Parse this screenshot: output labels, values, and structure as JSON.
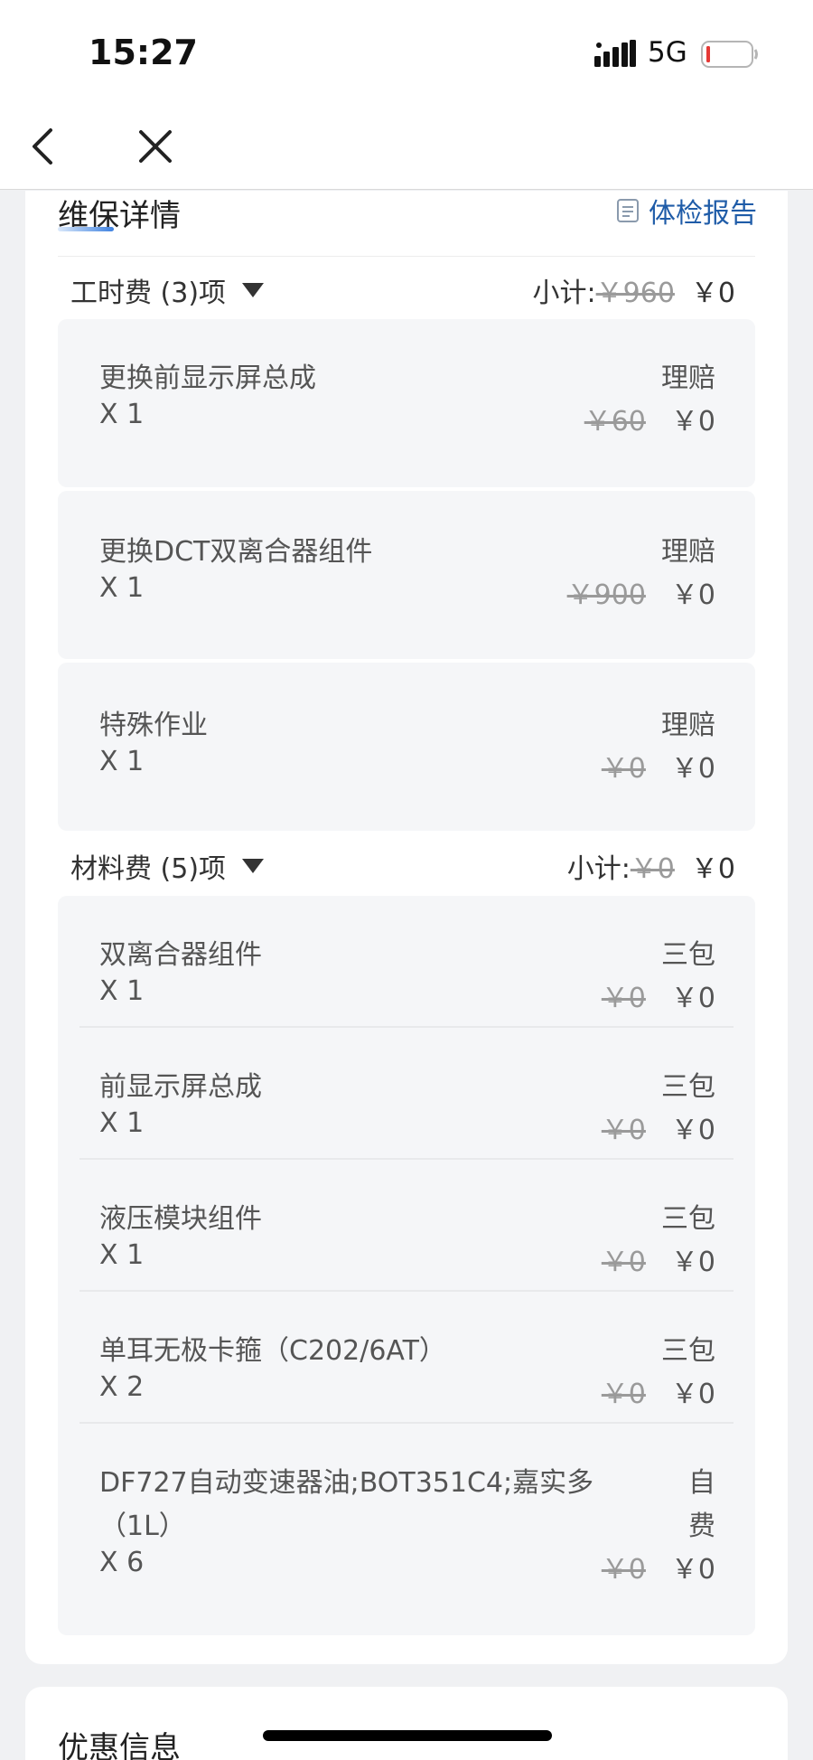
{
  "status_bar": {
    "time": "15:27",
    "network": "5G"
  },
  "card": {
    "title": "维保详情",
    "report_link": "体检报告"
  },
  "labor": {
    "section_label": "工时费 (3)项",
    "subtotal_label": "小计:",
    "subtotal_original": "￥960",
    "subtotal_final": "￥0",
    "items": [
      {
        "name": "更换前显示屏总成",
        "tag": "理赔",
        "qty": "X 1",
        "original": "￥60",
        "final": "￥0"
      },
      {
        "name": "更换DCT双离合器组件",
        "tag": "理赔",
        "qty": "X 1",
        "original": "￥900",
        "final": "￥0"
      },
      {
        "name": "特殊作业",
        "tag": "理赔",
        "qty": "X 1",
        "original": "￥0",
        "final": "￥0"
      }
    ]
  },
  "materials": {
    "section_label": "材料费 (5)项",
    "subtotal_label": "小计:",
    "subtotal_original": "￥0",
    "subtotal_final": "￥0",
    "items": [
      {
        "name": "双离合器组件",
        "tag": "三包",
        "qty": "X 1",
        "original": "￥0",
        "final": "￥0"
      },
      {
        "name": "前显示屏总成",
        "tag": "三包",
        "qty": "X 1",
        "original": "￥0",
        "final": "￥0"
      },
      {
        "name": "液压模块组件",
        "tag": "三包",
        "qty": "X 1",
        "original": "￥0",
        "final": "￥0"
      },
      {
        "name": "单耳无极卡箍（C202/6AT）",
        "tag": "三包",
        "qty": "X 2",
        "original": "￥0",
        "final": "￥0"
      },
      {
        "name_line1": "DF727自动变速器油;BOT351C4;嘉实多",
        "name_line2": "（1L）",
        "tag_line1": "自",
        "tag_line2": "费",
        "qty": "X 6",
        "original": "￥0",
        "final": "￥0"
      }
    ]
  },
  "next_card": {
    "title": "优惠信息"
  },
  "colors": {
    "link": "#1f5ca8",
    "accent": "#3f82e0",
    "item_bg": "#f5f6f8",
    "strike": "#9a9a9a"
  }
}
